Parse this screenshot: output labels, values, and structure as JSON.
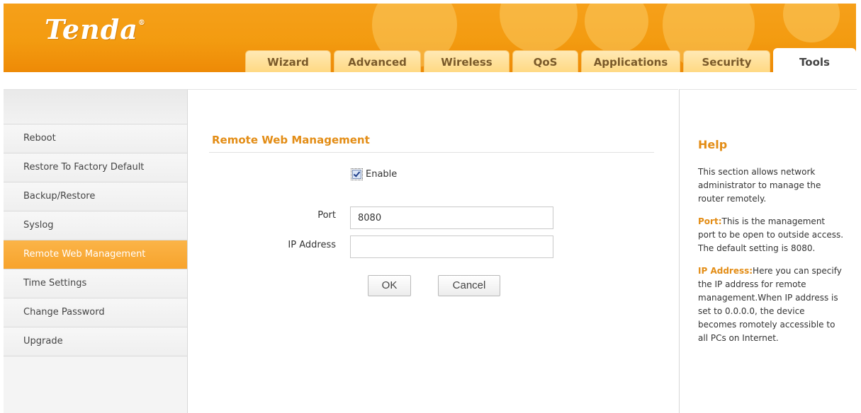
{
  "brand": {
    "logo_text": "Tenda",
    "logo_mark": "®"
  },
  "tabs": [
    {
      "label": "Wizard"
    },
    {
      "label": "Advanced"
    },
    {
      "label": "Wireless"
    },
    {
      "label": "QoS"
    },
    {
      "label": "Applications"
    },
    {
      "label": "Security"
    },
    {
      "label": "Tools"
    }
  ],
  "active_tab": "Tools",
  "sidebar": {
    "items": [
      {
        "label": "Reboot"
      },
      {
        "label": "Restore To Factory Default"
      },
      {
        "label": "Backup/Restore"
      },
      {
        "label": "Syslog"
      },
      {
        "label": "Remote Web Management"
      },
      {
        "label": "Time Settings"
      },
      {
        "label": "Change Password"
      },
      {
        "label": "Upgrade"
      }
    ],
    "active_item": "Remote Web Management"
  },
  "main": {
    "title": "Remote Web Management",
    "enable_label": "Enable",
    "enable_checked": true,
    "port_label": "Port",
    "port_value": "8080",
    "ip_label": "IP Address",
    "ip_value": "",
    "ok_label": "OK",
    "cancel_label": "Cancel"
  },
  "help": {
    "title": "Help",
    "intro": "This section allows network administrator to manage the router remotely.",
    "port_key": "Port:",
    "port_text": "This is the management port to be open to outside access. The default setting is 8080.",
    "ip_key": "IP Address:",
    "ip_text": "Here you can specify the IP address for remote management.When IP address is set to 0.0.0.0, the device becomes romotely accessible to all PCs on Internet."
  },
  "colors": {
    "header_orange": "#f39b10",
    "accent_orange": "#e38d16",
    "active_nav": "#f7a32c"
  }
}
